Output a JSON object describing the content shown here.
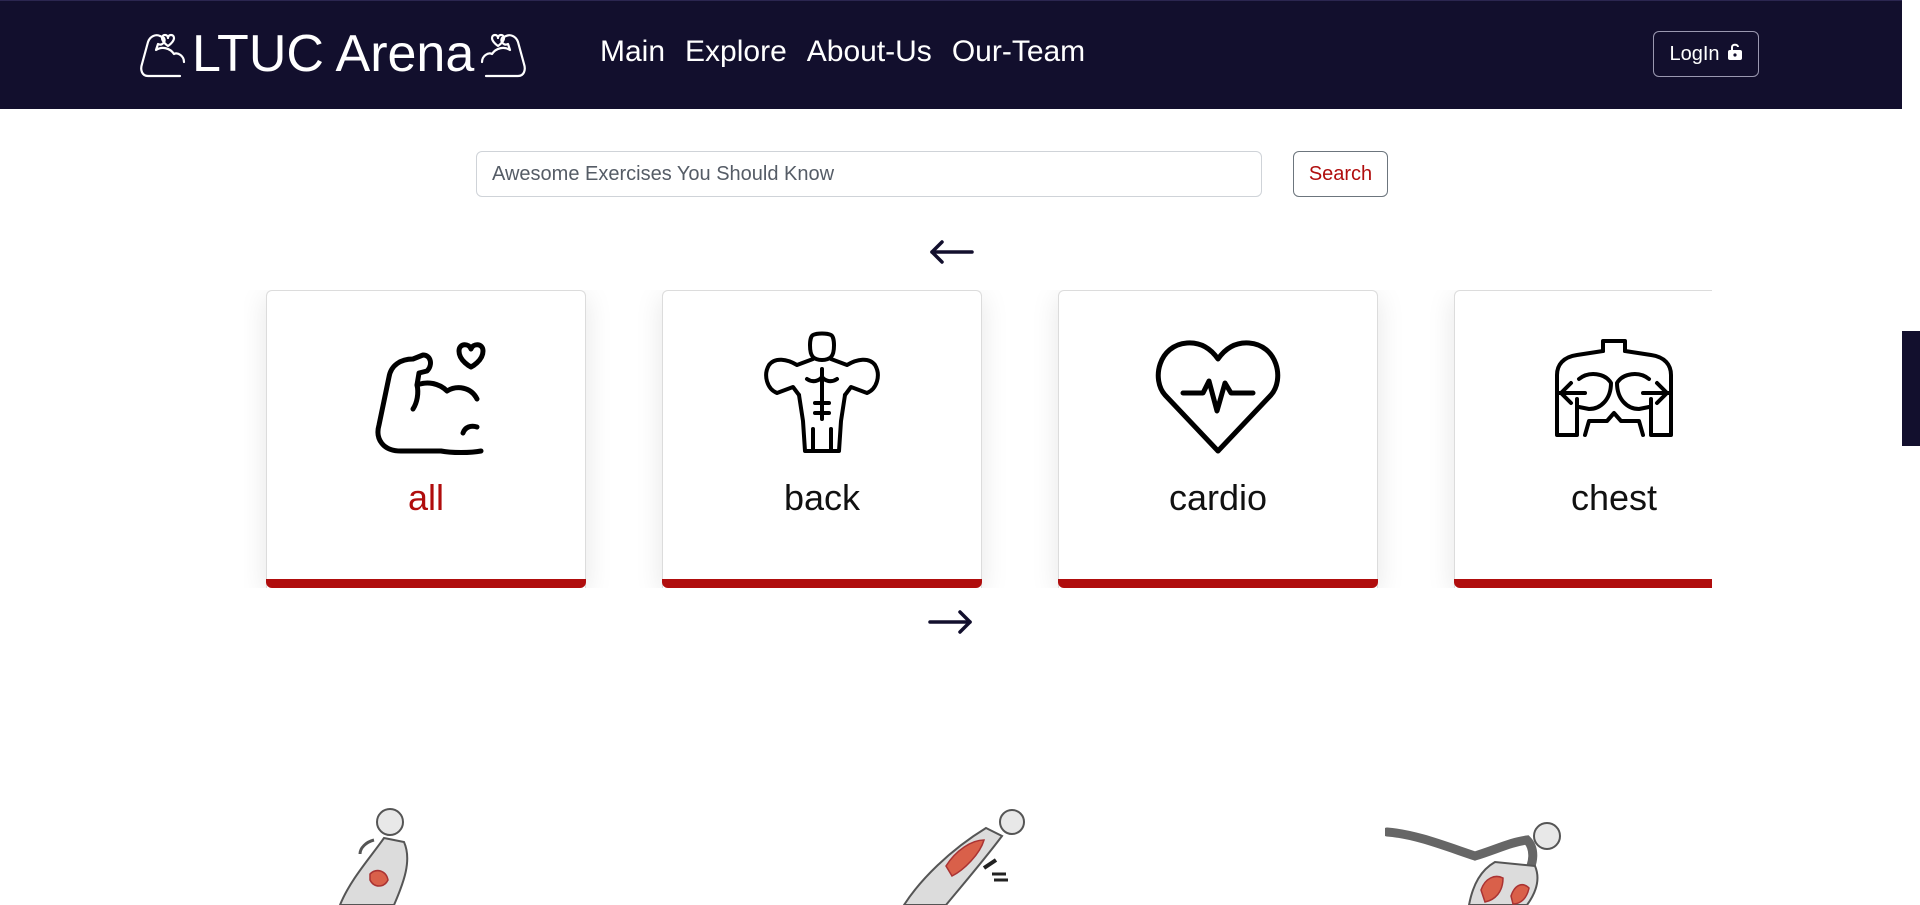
{
  "navbar": {
    "brand": "LTUC Arena",
    "links": [
      "Main",
      "Explore",
      "About-Us",
      "Our-Team"
    ],
    "login_label": "LogIn"
  },
  "search": {
    "value": "Awesome Exercises You Should Know",
    "button_label": "Search"
  },
  "categories": [
    {
      "label": "all",
      "icon": "flexed-arm-heart-icon",
      "active": true
    },
    {
      "label": "back",
      "icon": "bodybuilder-icon",
      "active": false
    },
    {
      "label": "cardio",
      "icon": "heart-pulse-icon",
      "active": false
    },
    {
      "label": "chest",
      "icon": "chest-muscle-icon",
      "active": false
    }
  ],
  "exercises": [
    {
      "icon": "crunch-exercise-icon"
    },
    {
      "icon": "incline-situp-exercise-icon"
    },
    {
      "icon": "air-bike-exercise-icon"
    }
  ],
  "colors": {
    "navbar_bg": "#120f2d",
    "accent_red": "#b00d0d",
    "text_dark": "#111111"
  }
}
